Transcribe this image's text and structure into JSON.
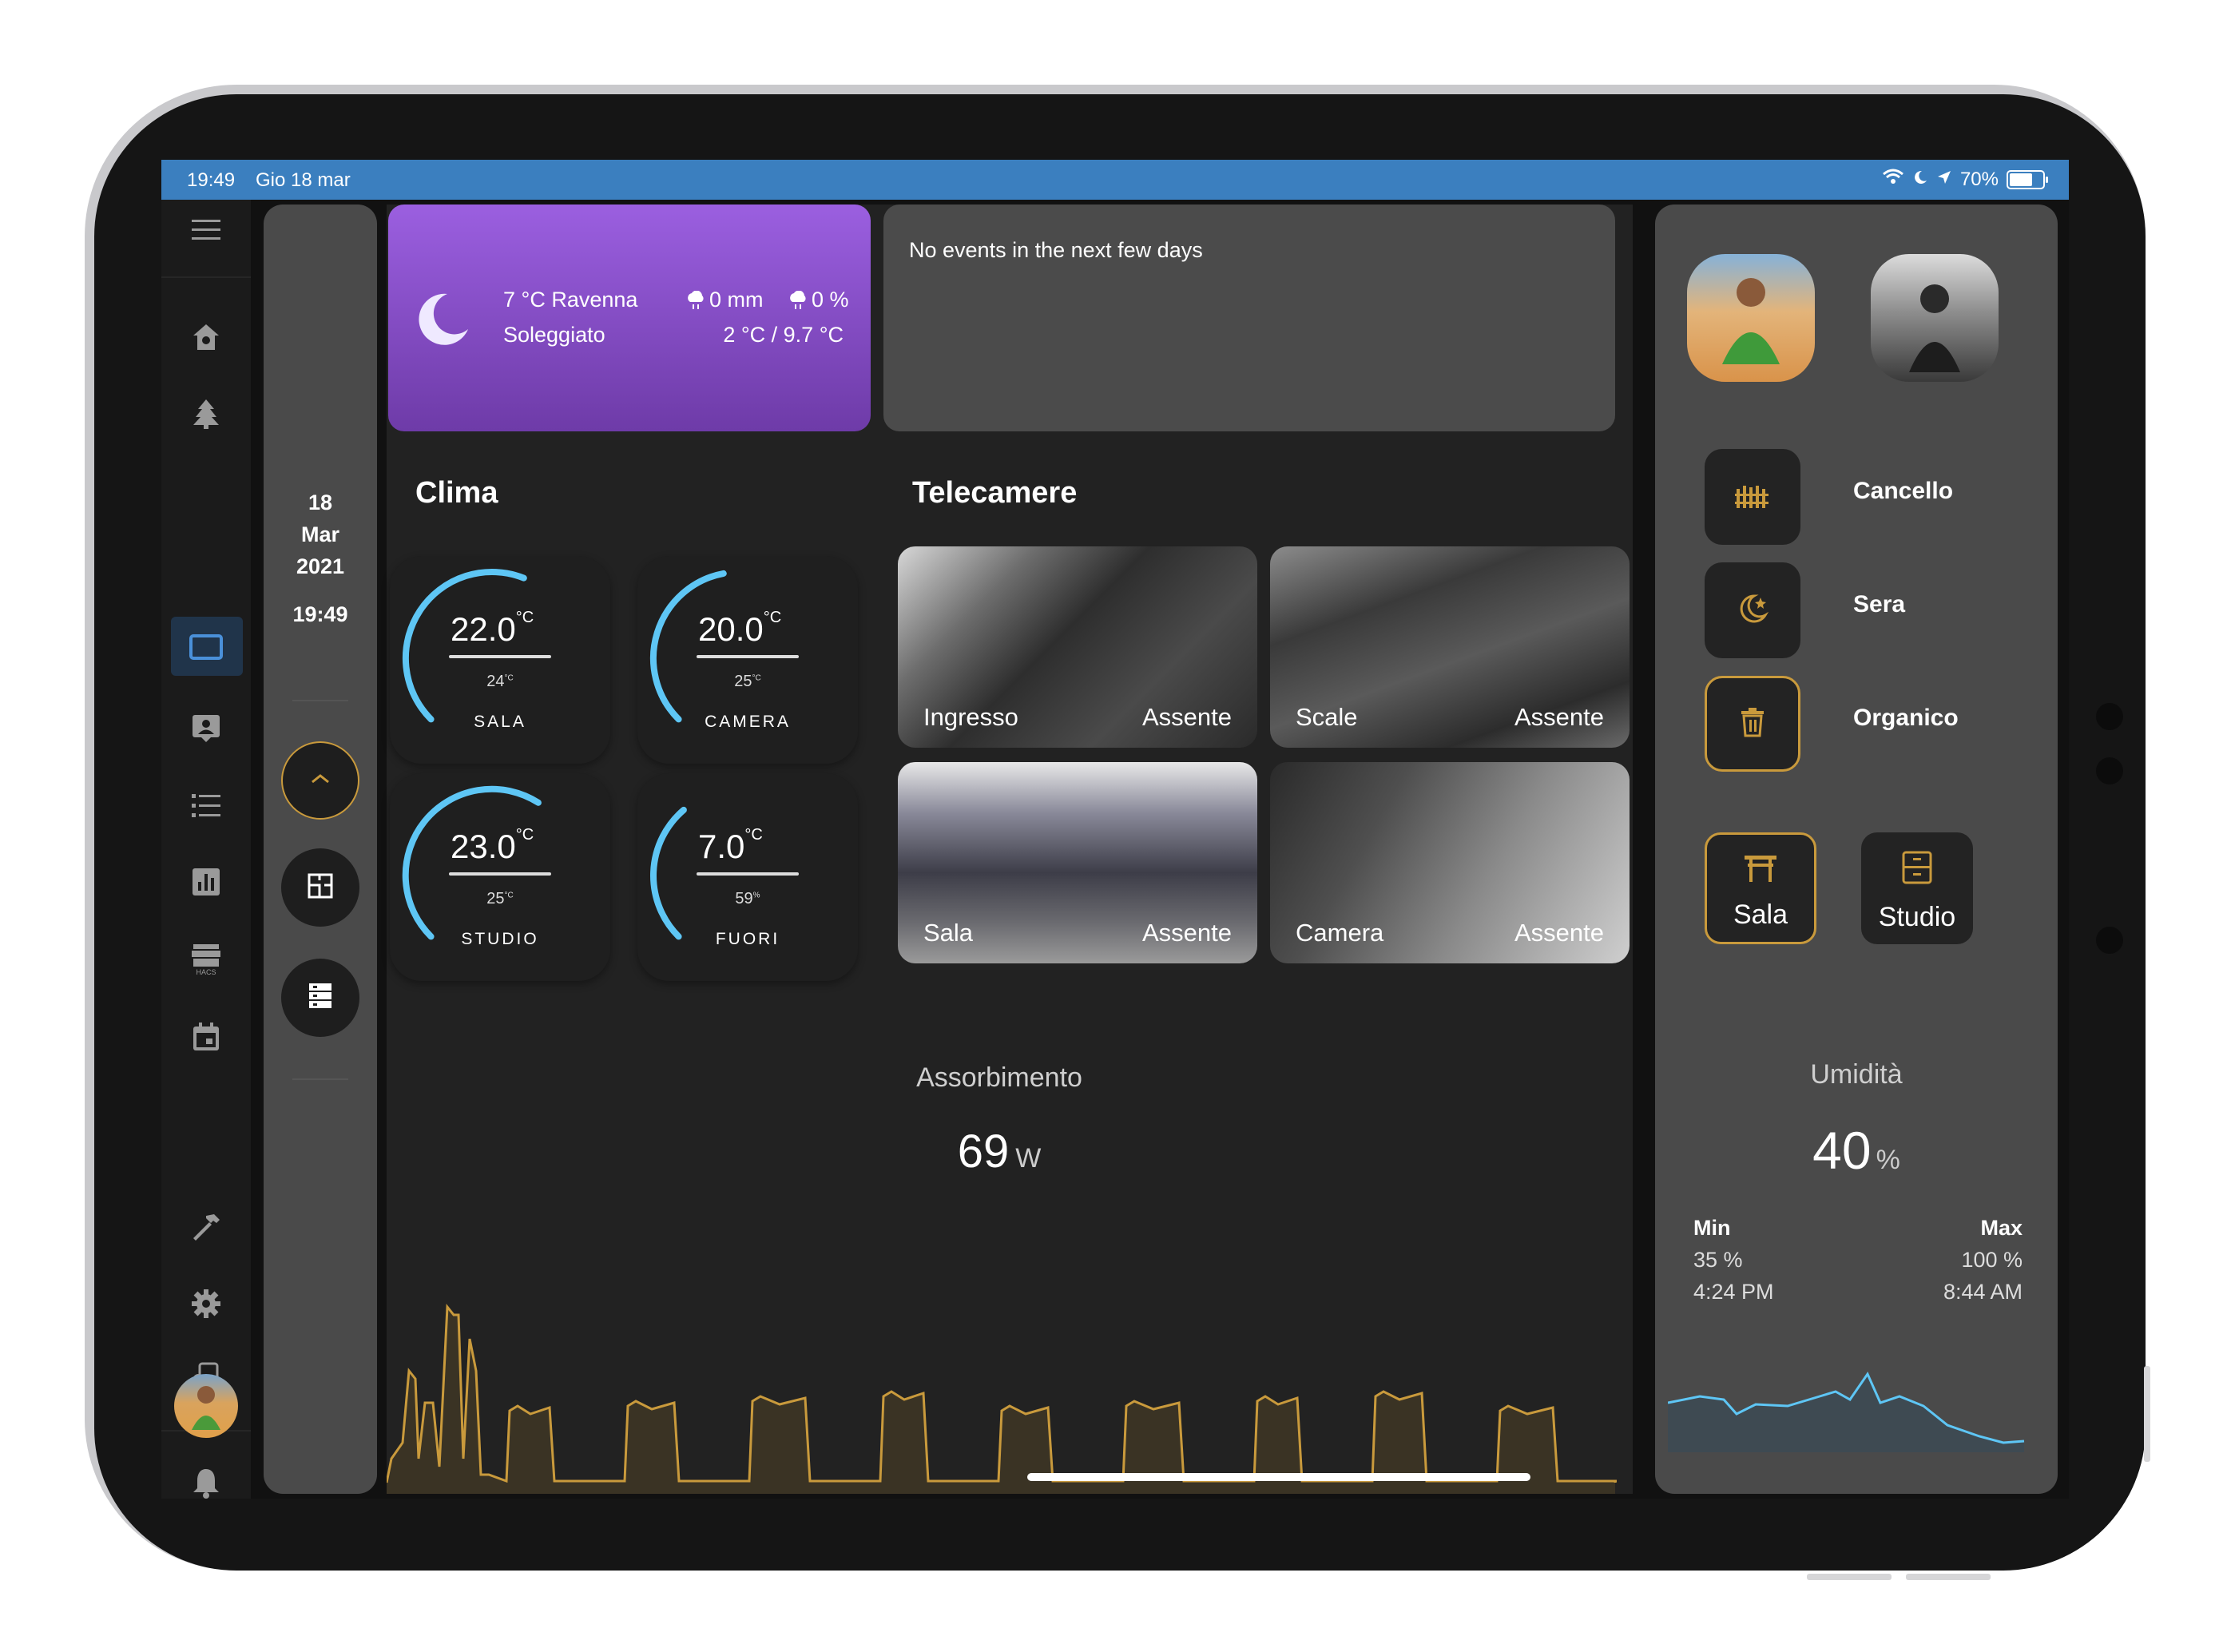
{
  "status_bar": {
    "time": "19:49",
    "date": "Gio 18 mar",
    "battery": "70%",
    "battery_level": 0.7
  },
  "sidebar": {
    "items": [
      {
        "icon": "home-icon"
      },
      {
        "icon": "tree-icon"
      },
      {
        "icon": "tablet-icon",
        "active": true
      },
      {
        "icon": "contact-icon"
      },
      {
        "icon": "list-icon"
      },
      {
        "icon": "chart-icon"
      },
      {
        "icon": "hacs-icon"
      },
      {
        "icon": "calendar-icon"
      },
      {
        "icon": "hammer-icon"
      },
      {
        "icon": "gear-icon"
      },
      {
        "icon": "device-cog-icon"
      },
      {
        "icon": "bell-icon"
      }
    ]
  },
  "clock": {
    "day": "18",
    "month": "Mar",
    "year": "2021",
    "time": "19:49"
  },
  "weather": {
    "temp_city": "7 °C Ravenna",
    "condition": "Soleggiato",
    "rain": "0 mm",
    "rain_chance": "0 %",
    "range": "2 °C / 9.7 °C"
  },
  "events": {
    "text": "No events in the next few days"
  },
  "clima": {
    "title": "Clima",
    "thermostats": [
      {
        "value": "22.0",
        "unit": "°C",
        "target": "24",
        "target_unit": "°C",
        "name": "SALA",
        "fraction": 0.58
      },
      {
        "value": "20.0",
        "unit": "°C",
        "target": "25",
        "target_unit": "°C",
        "name": "CAMERA",
        "fraction": 0.46
      },
      {
        "value": "23.0",
        "unit": "°C",
        "target": "25",
        "target_unit": "°C",
        "name": "STUDIO",
        "fraction": 0.62
      },
      {
        "value": "7.0",
        "unit": "°C",
        "target": "59",
        "target_unit": "%",
        "name": "FUORI",
        "fraction": 0.35
      }
    ]
  },
  "telecamere": {
    "title": "Telecamere",
    "cameras": [
      {
        "name": "Ingresso",
        "state": "Assente"
      },
      {
        "name": "Scale",
        "state": "Assente"
      },
      {
        "name": "Sala",
        "state": "Assente"
      },
      {
        "name": "Camera",
        "state": "Assente"
      }
    ]
  },
  "assorbimento": {
    "title": "Assorbimento",
    "value": "69",
    "unit": "W"
  },
  "right": {
    "actions": [
      {
        "label": "Cancello",
        "icon": "gate-icon",
        "on": false
      },
      {
        "label": "Sera",
        "icon": "moon-star-icon",
        "on": false
      },
      {
        "label": "Organico",
        "icon": "trash-icon",
        "on": true
      }
    ],
    "rooms": [
      {
        "label": "Sala",
        "icon": "table-icon",
        "on": true
      },
      {
        "label": "Studio",
        "icon": "desk-icon",
        "on": false
      }
    ],
    "umidita": {
      "title": "Umidità",
      "value": "40",
      "unit": "%",
      "min_label": "Min",
      "min_value": "35 %",
      "min_time": "4:24 PM",
      "max_label": "Max",
      "max_value": "100 %",
      "max_time": "8:44 AM"
    }
  },
  "colors": {
    "accent_gold": "#c99a3c",
    "weather_top": "#9b5fe0",
    "weather_bottom": "#6e3ba8",
    "arc_blue": "#5ec6f5",
    "statusbar": "#3b7fbf"
  }
}
